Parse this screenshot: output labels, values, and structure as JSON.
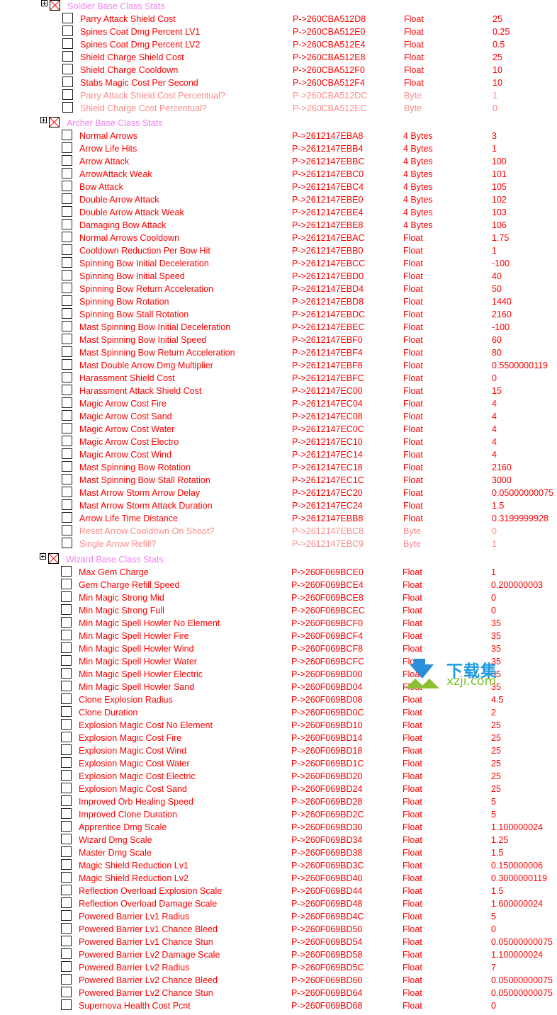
{
  "colors": {
    "active": "#ff0000",
    "inactive": "#ff8a8a",
    "group_header": "#f07ef0"
  },
  "sections": [
    {
      "title": "Soldier Base Class Stats",
      "items": [
        {
          "desc": "Parry Attack Shield Cost",
          "address": "P->260CBA512D8",
          "type": "Float",
          "value": "25"
        },
        {
          "desc": "Spines Coat Dmg Percent LV1",
          "address": "P->260CBA512E0",
          "type": "Float",
          "value": "0.25"
        },
        {
          "desc": "Spines Coat Dmg Percent LV2",
          "address": "P->260CBA512E4",
          "type": "Float",
          "value": "0.5"
        },
        {
          "desc": "Shield Charge Shield Cost",
          "address": "P->260CBA512E8",
          "type": "Float",
          "value": "25"
        },
        {
          "desc": "Shield Charge Cooldown",
          "address": "P->260CBA512F0",
          "type": "Float",
          "value": "10"
        },
        {
          "desc": "Stabs Magic Cost Per Second",
          "address": "P->260CBA512F4",
          "type": "Float",
          "value": "10"
        },
        {
          "desc": "Parry Attack Shield Cost Percentual?",
          "address": "P->260CBA512DC",
          "type": "Byte",
          "value": "1",
          "dim": true
        },
        {
          "desc": "Shield Charge Cost Percentual?",
          "address": "P->260CBA512EC",
          "type": "Byte",
          "value": "0",
          "dim": true
        }
      ]
    },
    {
      "title": "Archer Base Class Stats",
      "items": [
        {
          "desc": "Normal Arrows",
          "address": "P->2612147EBA8",
          "type": "4 Bytes",
          "value": "3"
        },
        {
          "desc": "Arrow Life Hits",
          "address": "P->2612147EBB4",
          "type": "4 Bytes",
          "value": "1"
        },
        {
          "desc": "Arrow Attack",
          "address": "P->2612147EBBC",
          "type": "4 Bytes",
          "value": "100"
        },
        {
          "desc": "ArrowAttack Weak",
          "address": "P->2612147EBC0",
          "type": "4 Bytes",
          "value": "101"
        },
        {
          "desc": "Bow Attack",
          "address": "P->2612147EBC4",
          "type": "4 Bytes",
          "value": "105"
        },
        {
          "desc": "Double Arrow Attack",
          "address": "P->2612147EBE0",
          "type": "4 Bytes",
          "value": "102"
        },
        {
          "desc": "Double Arrow Attack Weak",
          "address": "P->2612147EBE4",
          "type": "4 Bytes",
          "value": "103"
        },
        {
          "desc": "Damaging Bow Attack",
          "address": "P->2612147EBE8",
          "type": "4 Bytes",
          "value": "106"
        },
        {
          "desc": "Normal Arrows Cooldown",
          "address": "P->2612147EBAC",
          "type": "Float",
          "value": "1.75"
        },
        {
          "desc": "Cooldown Reduction Per Bow Hit",
          "address": "P->2612147EBB0",
          "type": "Float",
          "value": "1"
        },
        {
          "desc": "Spinning Bow Initial Deceleration",
          "address": "P->2612147EBCC",
          "type": "Float",
          "value": "-100"
        },
        {
          "desc": "Spinning Bow Initial Speed",
          "address": "P->2612147EBD0",
          "type": "Float",
          "value": "40"
        },
        {
          "desc": "Spinning Bow Return Acceleration",
          "address": "P->2612147EBD4",
          "type": "Float",
          "value": "50"
        },
        {
          "desc": "Spinning Bow Rotation",
          "address": "P->2612147EBD8",
          "type": "Float",
          "value": "1440"
        },
        {
          "desc": "Spinning Bow Stall Rotation",
          "address": "P->2612147EBDC",
          "type": "Float",
          "value": "2160"
        },
        {
          "desc": "Mast Spinning Bow Initial Deceleration",
          "address": "P->2612147EBEC",
          "type": "Float",
          "value": "-100"
        },
        {
          "desc": "Mast Spinning Bow Initial Speed",
          "address": "P->2612147EBF0",
          "type": "Float",
          "value": "60"
        },
        {
          "desc": "Mast Spinning Bow Return Acceleration",
          "address": "P->2612147EBF4",
          "type": "Float",
          "value": "80"
        },
        {
          "desc": "Mast Double Arrow Dmg Multiplier",
          "address": "P->2612147EBF8",
          "type": "Float",
          "value": "0.5500000119"
        },
        {
          "desc": "Harassment Shield Cost",
          "address": "P->2612147EBFC",
          "type": "Float",
          "value": "0"
        },
        {
          "desc": "Harassment Attack Shield Cost",
          "address": "P->2612147EC00",
          "type": "Float",
          "value": "15"
        },
        {
          "desc": "Magic Arrow Cost Fire",
          "address": "P->2612147EC04",
          "type": "Float",
          "value": "4"
        },
        {
          "desc": "Magic Arrow Cost Sand",
          "address": "P->2612147EC08",
          "type": "Float",
          "value": "4"
        },
        {
          "desc": "Magic Arrow Cost Water",
          "address": "P->2612147EC0C",
          "type": "Float",
          "value": "4"
        },
        {
          "desc": "Magic Arrow Cost Electro",
          "address": "P->2612147EC10",
          "type": "Float",
          "value": "4"
        },
        {
          "desc": "Magic Arrow Cost Wind",
          "address": "P->2612147EC14",
          "type": "Float",
          "value": "4"
        },
        {
          "desc": "Mast Spinning Bow Rotation",
          "address": "P->2612147EC18",
          "type": "Float",
          "value": "2160"
        },
        {
          "desc": "Mast Spinning Bow Stall Rotation",
          "address": "P->2612147EC1C",
          "type": "Float",
          "value": "3000"
        },
        {
          "desc": "Mast Arrow Storm Arrow Delay",
          "address": "P->2612147EC20",
          "type": "Float",
          "value": "0.05000000075"
        },
        {
          "desc": "Mast Arrow Storm Attack Duration",
          "address": "P->2612147EC24",
          "type": "Float",
          "value": "1.5"
        },
        {
          "desc": "Arrow Life Time Distance",
          "address": "P->2612147EBB8",
          "type": "Float",
          "value": "0.3199999928"
        },
        {
          "desc": "Reset Arrow Cooldown On Shoot?",
          "address": "P->2612147EBC8",
          "type": "Byte",
          "value": "0",
          "dim": true
        },
        {
          "desc": "Single Arrow Refill?",
          "address": "P->2612147EBC9",
          "type": "Byte",
          "value": "1",
          "dim": true
        }
      ]
    },
    {
      "title": "Wizard Base Class Stats",
      "items": [
        {
          "desc": "Max Gem Charge",
          "address": "P->260F069BCE0",
          "type": "Float",
          "value": "1"
        },
        {
          "desc": "Gem Charge Refill Speed",
          "address": "P->260F069BCE4",
          "type": "Float",
          "value": "0.200000003"
        },
        {
          "desc": "Min Magic Strong Mid",
          "address": "P->260F069BCE8",
          "type": "Float",
          "value": "0"
        },
        {
          "desc": "Min Magic Strong Full",
          "address": "P->260F069BCEC",
          "type": "Float",
          "value": "0"
        },
        {
          "desc": "Min Magic Spell Howler No Element",
          "address": "P->260F069BCF0",
          "type": "Float",
          "value": "35"
        },
        {
          "desc": "Min Magic Spell Howler Fire",
          "address": "P->260F069BCF4",
          "type": "Float",
          "value": "35"
        },
        {
          "desc": "Min Magic Spell Howler Wind",
          "address": "P->260F069BCF8",
          "type": "Float",
          "value": "35"
        },
        {
          "desc": "Min Magic Spell Howler Water",
          "address": "P->260F069BCFC",
          "type": "Float",
          "value": "35"
        },
        {
          "desc": "Min Magic Spell Howler Electric",
          "address": "P->260F069BD00",
          "type": "Float",
          "value": "35"
        },
        {
          "desc": "Min Magic Spell Howler Sand",
          "address": "P->260F069BD04",
          "type": "Float",
          "value": "35"
        },
        {
          "desc": "Clone Explosion Radius",
          "address": "P->260F069BD08",
          "type": "Float",
          "value": "4.5"
        },
        {
          "desc": "Clone Duration",
          "address": "P->260F069BD0C",
          "type": "Float",
          "value": "2"
        },
        {
          "desc": "Explosion Magic Cost No Element",
          "address": "P->260F069BD10",
          "type": "Float",
          "value": "25"
        },
        {
          "desc": "Explosion Magic Cost Fire",
          "address": "P->260F069BD14",
          "type": "Float",
          "value": "25"
        },
        {
          "desc": "Explosion Magic Cost Wind",
          "address": "P->260F069BD18",
          "type": "Float",
          "value": "25"
        },
        {
          "desc": "Explosion Magic Cost Water",
          "address": "P->260F069BD1C",
          "type": "Float",
          "value": "25"
        },
        {
          "desc": "Explosion Magic Cost Electric",
          "address": "P->260F069BD20",
          "type": "Float",
          "value": "25"
        },
        {
          "desc": "Explosion Magic Cost Sand",
          "address": "P->260F069BD24",
          "type": "Float",
          "value": "25"
        },
        {
          "desc": "Improved Orb Healing Speed",
          "address": "P->260F069BD28",
          "type": "Float",
          "value": "5"
        },
        {
          "desc": "Improved Clone Duration",
          "address": "P->260F069BD2C",
          "type": "Float",
          "value": "5"
        },
        {
          "desc": "Apprentice Dmg Scale",
          "address": "P->260F069BD30",
          "type": "Float",
          "value": "1.100000024"
        },
        {
          "desc": "Wizard Dmg Scale",
          "address": "P->260F069BD34",
          "type": "Float",
          "value": "1.25"
        },
        {
          "desc": "Master Dmg Scale",
          "address": "P->260F069BD38",
          "type": "Float",
          "value": "1.5"
        },
        {
          "desc": "Magic Shield Reduction Lv1",
          "address": "P->260F069BD3C",
          "type": "Float",
          "value": "0.150000006"
        },
        {
          "desc": "Magic Shield Reduction Lv2",
          "address": "P->260F069BD40",
          "type": "Float",
          "value": "0.3000000119"
        },
        {
          "desc": "Reflection Overload Explosion Scale",
          "address": "P->260F069BD44",
          "type": "Float",
          "value": "1.5"
        },
        {
          "desc": "Reflection Overload Damage Scale",
          "address": "P->260F069BD48",
          "type": "Float",
          "value": "1.600000024"
        },
        {
          "desc": "Powered Barrier Lv1 Radius",
          "address": "P->260F069BD4C",
          "type": "Float",
          "value": "5"
        },
        {
          "desc": "Powered Barrier Lv1 Chance Bleed",
          "address": "P->260F069BD50",
          "type": "Float",
          "value": "0"
        },
        {
          "desc": "Powered Barrier Lv1 Chance Stun",
          "address": "P->260F069BD54",
          "type": "Float",
          "value": "0.05000000075"
        },
        {
          "desc": "Powered Barrier Lv2 Damage Scale",
          "address": "P->260F069BD58",
          "type": "Float",
          "value": "1.100000024"
        },
        {
          "desc": "Powered Barrier Lv2 Radius",
          "address": "P->260F069BD5C",
          "type": "Float",
          "value": "7"
        },
        {
          "desc": "Powered Barrier Lv2 Chance Bleed",
          "address": "P->260F069BD60",
          "type": "Float",
          "value": "0.05000000075"
        },
        {
          "desc": "Powered Barrier Lv2 Chance Stun",
          "address": "P->260F069BD64",
          "type": "Float",
          "value": "0.05000000075"
        },
        {
          "desc": "Supernova Health Cost Pcnt",
          "address": "P->260F069BD68",
          "type": "Float",
          "value": "0"
        }
      ]
    }
  ],
  "watermark": {
    "text_cn": "下载集",
    "text_site": "xzji.com",
    "icon": "download-arrow-logo"
  }
}
